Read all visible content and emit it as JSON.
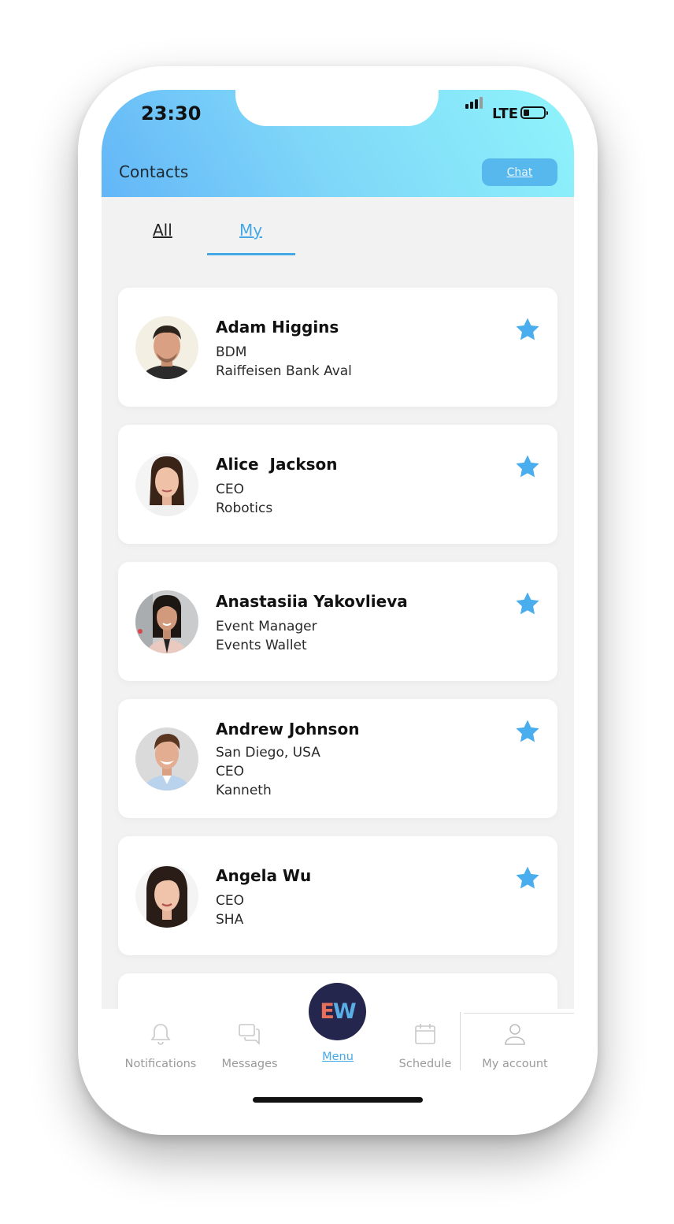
{
  "status_bar": {
    "time": "23:30",
    "network": "LTE"
  },
  "header": {
    "title": "Contacts",
    "chat_label": "Chat"
  },
  "tabs": [
    {
      "label": "All",
      "active": false
    },
    {
      "label": "My",
      "active": true
    }
  ],
  "contacts": [
    {
      "name": "Adam Higgins",
      "lines": [
        "BDM",
        "Raiffeisen Bank Aval"
      ],
      "favorite": true
    },
    {
      "name": "Alice  Jackson",
      "lines": [
        "CEO",
        "Robotics"
      ],
      "favorite": true
    },
    {
      "name": "Anastasiia Yakovlieva",
      "lines": [
        "Event Manager",
        "Events Wallet"
      ],
      "favorite": true
    },
    {
      "name": "Andrew Johnson",
      "lines": [
        "San Diego, USA",
        "CEO",
        "Kanneth"
      ],
      "favorite": true
    },
    {
      "name": "Angela Wu",
      "lines": [
        "CEO",
        "SHA"
      ],
      "favorite": true
    }
  ],
  "bottom_nav": {
    "notifications": {
      "label": "Notifications",
      "icon": "bell-icon"
    },
    "messages": {
      "label": "Messages",
      "icon": "chat-bubbles-icon"
    },
    "menu": {
      "label": "Menu",
      "logo": "EW",
      "logo_e": "E",
      "logo_w": "W"
    },
    "schedule": {
      "label": "Schedule",
      "icon": "calendar-icon"
    },
    "account": {
      "label": "My account",
      "icon": "user-icon"
    }
  },
  "colors": {
    "accent": "#45a9e6",
    "star": "#4aaeee",
    "fab": "#25264e",
    "header_gradient_start": "#63b6f7",
    "header_gradient_end": "#8ff4fb"
  }
}
